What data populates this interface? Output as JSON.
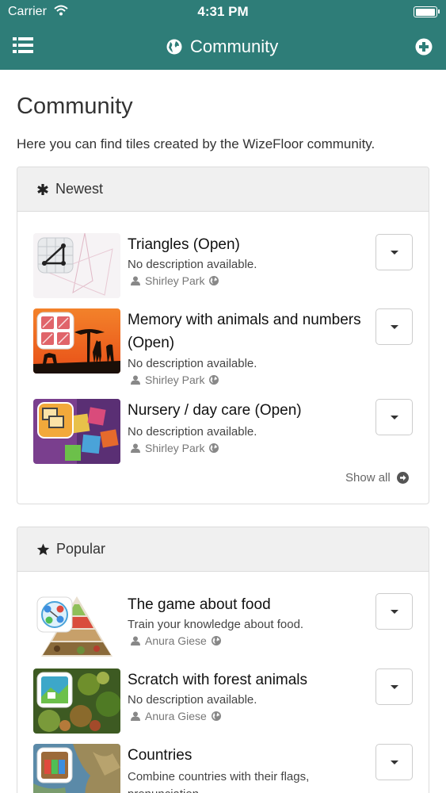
{
  "status_bar": {
    "carrier": "Carrier",
    "time": "4:31 PM"
  },
  "nav": {
    "title": "Community",
    "menu_icon": "list-icon",
    "globe_icon": "globe-icon",
    "add_icon": "plus-circle-icon"
  },
  "page": {
    "title": "Community",
    "intro": "Here you can find tiles created by the WizeFloor community."
  },
  "newest": {
    "heading": "Newest",
    "heading_icon": "asterisk-icon",
    "show_all": "Show all",
    "tiles": [
      {
        "title": "Triangles (Open)",
        "description": "No description available.",
        "author": "Shirley Park"
      },
      {
        "title": "Memory with animals and numbers (Open)",
        "description": "No description available.",
        "author": "Shirley Park"
      },
      {
        "title": "Nursery / day care (Open)",
        "description": "No description available.",
        "author": "Shirley Park"
      }
    ]
  },
  "popular": {
    "heading": "Popular",
    "heading_icon": "star-icon",
    "tiles": [
      {
        "title": "The game about food",
        "description": "Train your knowledge about food.",
        "author": "Anura Giese"
      },
      {
        "title": "Scratch with forest animals",
        "description": "No description available.",
        "author": "Anura Giese"
      },
      {
        "title": "Countries",
        "description": "Combine countries with their flags, pronunciation"
      }
    ]
  },
  "colors": {
    "header": "#2e7d78",
    "panel_header": "#f0f0f0"
  }
}
